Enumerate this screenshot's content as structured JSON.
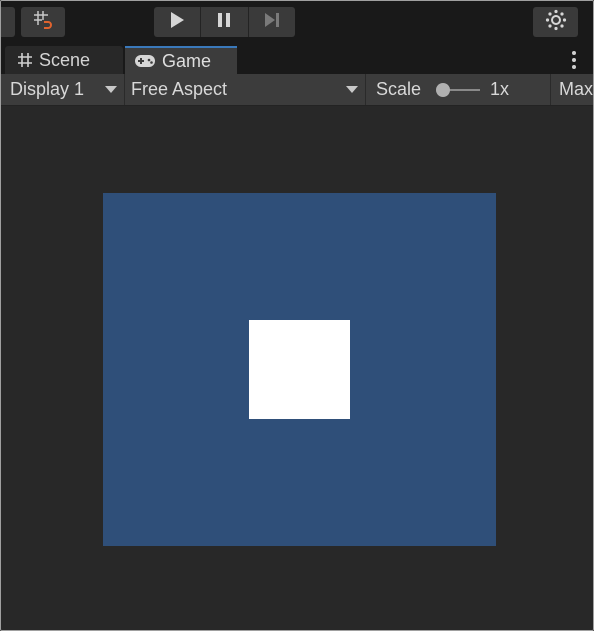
{
  "toolbar": {
    "play_icon": "play-icon",
    "pause_icon": "pause-icon",
    "step_icon": "step-icon",
    "grid_icon": "grid-snap-icon",
    "lighting_icon": "lighting-icon"
  },
  "tabs": [
    {
      "label": "Scene",
      "icon": "hash-icon",
      "active": false
    },
    {
      "label": "Game",
      "icon": "gamepad-icon",
      "active": true
    }
  ],
  "controls": {
    "display": "Display 1",
    "aspect": "Free Aspect",
    "scale_label": "Scale",
    "scale_value": "1x",
    "max_label": "Max"
  },
  "game": {
    "background_color": "#2f4f79",
    "square_color": "#ffffff"
  },
  "colors": {
    "accent": "#3a79bb",
    "grid_icon_accent": "#e0632e"
  }
}
